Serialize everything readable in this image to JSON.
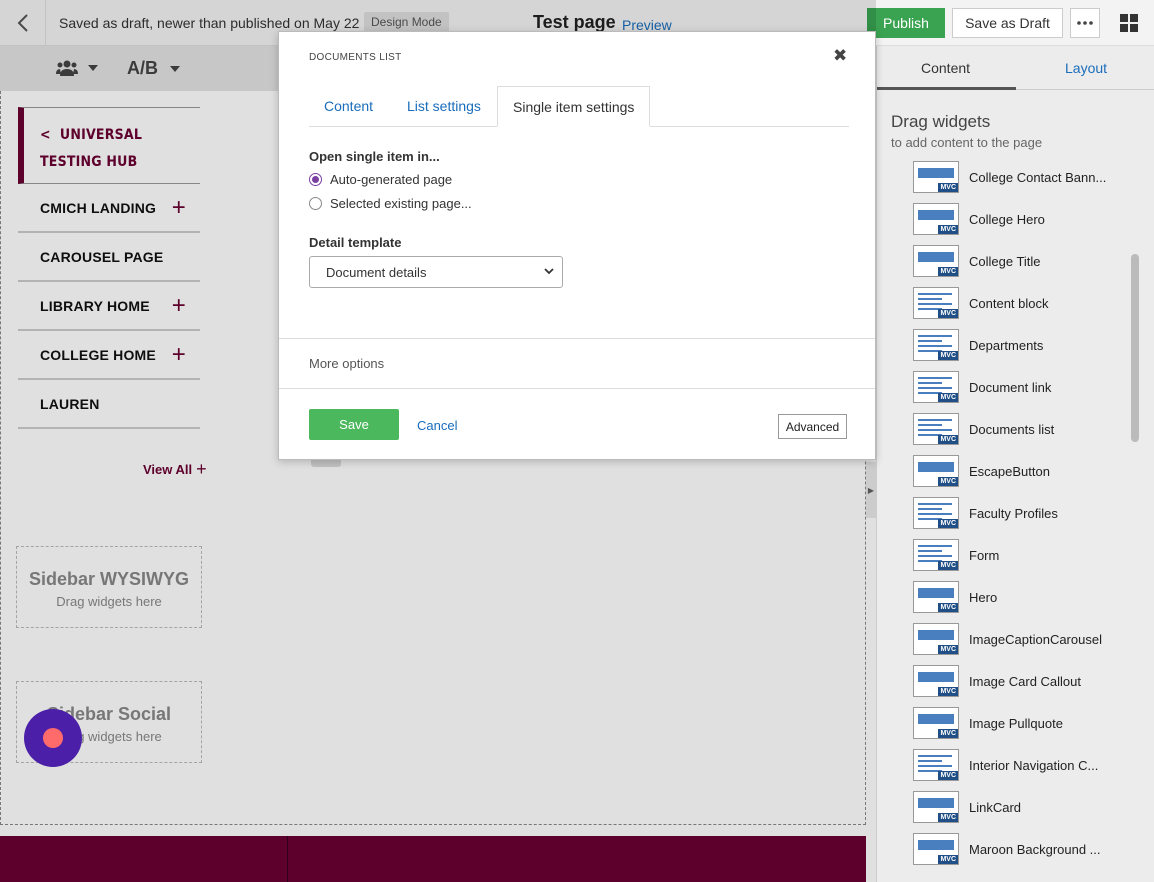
{
  "topbar": {
    "draft_status": "Saved as draft, newer than published on May 22",
    "mode_badge": "Design Mode",
    "page_title": "Test page",
    "preview": "Preview",
    "publish": "Publish",
    "save_draft": "Save as Draft"
  },
  "toolbar": {
    "ab": "A/B"
  },
  "nav": {
    "header_line1": "UNIVERSAL",
    "header_line2": "TESTING HUB",
    "items": [
      {
        "label": "CMICH LANDING",
        "expandable": true
      },
      {
        "label": "CAROUSEL PAGE",
        "expandable": false
      },
      {
        "label": "LIBRARY HOME",
        "expandable": true
      },
      {
        "label": "COLLEGE HOME",
        "expandable": true
      },
      {
        "label": "LAUREN",
        "expandable": false
      }
    ],
    "view_all": "View All"
  },
  "dropzones": [
    {
      "title": "Sidebar WYSIWYG",
      "hint": "Drag widgets here"
    },
    {
      "title": "Sidebar Social",
      "hint": "Drag widgets here"
    }
  ],
  "right_panel": {
    "tab_content": "Content",
    "tab_layout": "Layout",
    "title": "Drag widgets",
    "subtitle": "to add content to the page",
    "widgets": [
      "College Contact Bann...",
      "College Hero",
      "College Title",
      "Content block",
      "Departments",
      "Document link",
      "Documents list",
      "EscapeButton",
      "Faculty Profiles",
      "Form",
      "Hero",
      "ImageCaptionCarousel",
      "Image Card Callout",
      "Image Pullquote",
      "Interior Navigation C...",
      "LinkCard",
      "Maroon Background ..."
    ],
    "mvc_badge": "MVC"
  },
  "modal": {
    "title": "DOCUMENTS LIST",
    "tabs": [
      "Content",
      "List settings",
      "Single item settings"
    ],
    "active_tab": 2,
    "open_label": "Open single item in...",
    "radio_auto": "Auto-generated page",
    "radio_existing": "Selected existing page...",
    "template_label": "Detail template",
    "template_value": "Document details",
    "more_options": "More options",
    "save": "Save",
    "cancel": "Cancel",
    "advanced": "Advanced"
  },
  "colors": {
    "maroon": "#6a0032",
    "publish_green": "#3aa351",
    "link_blue": "#1a6dbb",
    "chat_purple": "#4b1fa8"
  }
}
